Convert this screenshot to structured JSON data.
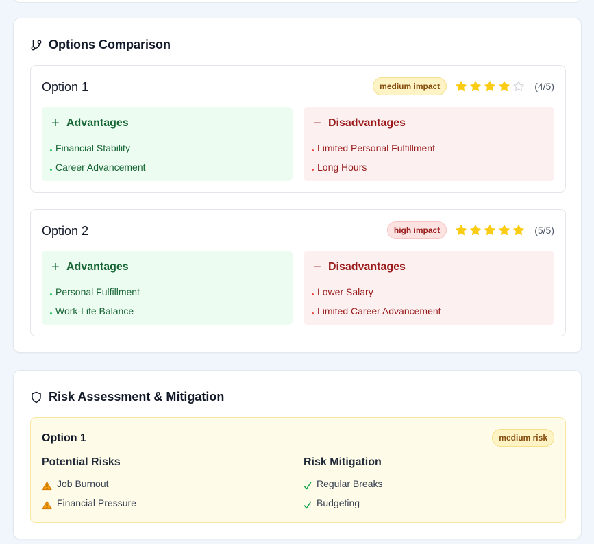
{
  "options_card": {
    "title": "Options Comparison",
    "icon": "git-branch-icon",
    "options": [
      {
        "name": "Option 1",
        "impact_label": "medium impact",
        "impact_color": "#fdf3c4",
        "rating": 4,
        "rating_max": 5,
        "rating_text": "(4/5)",
        "advantages_label": "Advantages",
        "advantages": [
          "Financial Stability",
          "Career Advancement"
        ],
        "disadvantages_label": "Disadvantages",
        "disadvantages": [
          "Limited Personal Fulfillment",
          "Long Hours"
        ]
      },
      {
        "name": "Option 2",
        "impact_label": "high impact",
        "impact_color": "#fde2e2",
        "rating": 5,
        "rating_max": 5,
        "rating_text": "(5/5)",
        "advantages_label": "Advantages",
        "advantages": [
          "Personal Fulfillment",
          "Work-Life Balance"
        ],
        "disadvantages_label": "Disadvantages",
        "disadvantages": [
          "Lower Salary",
          "Limited Career Advancement"
        ]
      }
    ]
  },
  "risk_card": {
    "title": "Risk Assessment & Mitigation",
    "icon": "shield-icon",
    "option": {
      "name": "Option 1",
      "risk_label": "medium risk",
      "risks_heading": "Potential Risks",
      "risks": [
        "Job Burnout",
        "Financial Pressure"
      ],
      "mitigation_heading": "Risk Mitigation",
      "mitigations": [
        "Regular Breaks",
        "Budgeting"
      ]
    }
  },
  "colors": {
    "star_filled": "#facc15",
    "star_empty": "#d1d5db",
    "advantage_text": "#166534",
    "disadvantage_text": "#991b1b",
    "risk_box_bg": "#fefce8"
  }
}
